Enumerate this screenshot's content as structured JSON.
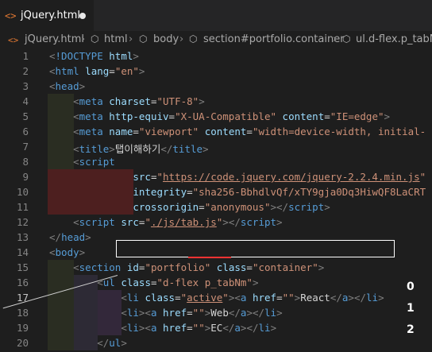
{
  "tab": {
    "icon": "<>",
    "label": "jQuery.html"
  },
  "breadcrumb": [
    "jQuery.html",
    "html",
    "body",
    "section#portfolio.container",
    "ul.d-flex.p_tabNm"
  ],
  "editor": {
    "current_line": 17,
    "lines": [
      {
        "n": "1",
        "tokens": [
          [
            "b",
            "<"
          ],
          [
            "t",
            "!DOCTYPE"
          ],
          [
            "w",
            " "
          ],
          [
            "a",
            "html"
          ],
          [
            "b",
            ">"
          ]
        ]
      },
      {
        "n": "2",
        "tokens": [
          [
            "b",
            "<"
          ],
          [
            "t",
            "html"
          ],
          [
            "w",
            " "
          ],
          [
            "a",
            "lang"
          ],
          [
            "w",
            "="
          ],
          [
            "s",
            "\"en\""
          ],
          [
            "b",
            ">"
          ]
        ]
      },
      {
        "n": "3",
        "tokens": [
          [
            "b",
            "<"
          ],
          [
            "t",
            "head"
          ],
          [
            "b",
            ">"
          ]
        ]
      },
      {
        "n": "4",
        "tokens": [
          [
            "w",
            "    "
          ],
          [
            "b",
            "<"
          ],
          [
            "t",
            "meta"
          ],
          [
            "w",
            " "
          ],
          [
            "a",
            "charset"
          ],
          [
            "w",
            "="
          ],
          [
            "s",
            "\"UTF-8\""
          ],
          [
            "b",
            ">"
          ]
        ]
      },
      {
        "n": "5",
        "tokens": [
          [
            "w",
            "    "
          ],
          [
            "b",
            "<"
          ],
          [
            "t",
            "meta"
          ],
          [
            "w",
            " "
          ],
          [
            "a",
            "http-equiv"
          ],
          [
            "w",
            "="
          ],
          [
            "s",
            "\"X-UA-Compatible\""
          ],
          [
            "w",
            " "
          ],
          [
            "a",
            "content"
          ],
          [
            "w",
            "="
          ],
          [
            "s",
            "\"IE=edge\""
          ],
          [
            "b",
            ">"
          ]
        ]
      },
      {
        "n": "6",
        "tokens": [
          [
            "w",
            "    "
          ],
          [
            "b",
            "<"
          ],
          [
            "t",
            "meta"
          ],
          [
            "w",
            " "
          ],
          [
            "a",
            "name"
          ],
          [
            "w",
            "="
          ],
          [
            "s",
            "\"viewport\""
          ],
          [
            "w",
            " "
          ],
          [
            "a",
            "content"
          ],
          [
            "w",
            "="
          ],
          [
            "s",
            "\"width=device-width, initial-"
          ]
        ]
      },
      {
        "n": "7",
        "tokens": [
          [
            "w",
            "    "
          ],
          [
            "b",
            "<"
          ],
          [
            "t",
            "title"
          ],
          [
            "b",
            ">"
          ],
          [
            "w",
            "탭이해하기"
          ],
          [
            "b",
            "</"
          ],
          [
            "t",
            "title"
          ],
          [
            "b",
            ">"
          ]
        ]
      },
      {
        "n": "8",
        "tokens": [
          [
            "w",
            "    "
          ],
          [
            "b",
            "<"
          ],
          [
            "t",
            "script"
          ]
        ]
      },
      {
        "n": "9",
        "tokens": [
          [
            "w",
            "              "
          ],
          [
            "a",
            "src"
          ],
          [
            "w",
            "="
          ],
          [
            "s",
            "\""
          ],
          [
            "su",
            "https://code.jquery.com/jquery-2.2.4.min.js"
          ],
          [
            "s",
            "\""
          ]
        ]
      },
      {
        "n": "10",
        "tokens": [
          [
            "w",
            "              "
          ],
          [
            "a",
            "integrity"
          ],
          [
            "w",
            "="
          ],
          [
            "s",
            "\"sha256-BbhdlvQf/xTY9gja0Dq3HiwQF8LaCRT"
          ]
        ]
      },
      {
        "n": "11",
        "tokens": [
          [
            "w",
            "              "
          ],
          [
            "a",
            "crossorigin"
          ],
          [
            "w",
            "="
          ],
          [
            "s",
            "\"anonymous\""
          ],
          [
            "b",
            "></"
          ],
          [
            "t",
            "script"
          ],
          [
            "b",
            ">"
          ]
        ]
      },
      {
        "n": "12",
        "tokens": [
          [
            "w",
            "    "
          ],
          [
            "b",
            "<"
          ],
          [
            "t",
            "script"
          ],
          [
            "w",
            " "
          ],
          [
            "a",
            "src"
          ],
          [
            "w",
            "="
          ],
          [
            "s",
            "\""
          ],
          [
            "su",
            "./js/tab.js"
          ],
          [
            "s",
            "\""
          ],
          [
            "b",
            "></"
          ],
          [
            "t",
            "script"
          ],
          [
            "b",
            ">"
          ]
        ]
      },
      {
        "n": "13",
        "tokens": [
          [
            "b",
            "</"
          ],
          [
            "t",
            "head"
          ],
          [
            "b",
            ">"
          ]
        ]
      },
      {
        "n": "14",
        "tokens": [
          [
            "b",
            "<"
          ],
          [
            "t",
            "body"
          ],
          [
            "b",
            ">"
          ]
        ]
      },
      {
        "n": "15",
        "tokens": [
          [
            "w",
            "    "
          ],
          [
            "b",
            "<"
          ],
          [
            "t",
            "section"
          ],
          [
            "w",
            " "
          ],
          [
            "a",
            "id"
          ],
          [
            "w",
            "="
          ],
          [
            "s",
            "\"portfolio\""
          ],
          [
            "w",
            " "
          ],
          [
            "a",
            "class"
          ],
          [
            "w",
            "="
          ],
          [
            "s",
            "\"container\""
          ],
          [
            "b",
            ">"
          ]
        ]
      },
      {
        "n": "16",
        "tokens": [
          [
            "w",
            "        "
          ],
          [
            "b",
            "<"
          ],
          [
            "t",
            "ul"
          ],
          [
            "w",
            " "
          ],
          [
            "a",
            "class"
          ],
          [
            "w",
            "="
          ],
          [
            "s",
            "\"d-flex p_tabNm\""
          ],
          [
            "b",
            ">"
          ]
        ]
      },
      {
        "n": "17",
        "tokens": [
          [
            "w",
            "            "
          ],
          [
            "b",
            "<"
          ],
          [
            "t",
            "li"
          ],
          [
            "w",
            " "
          ],
          [
            "a",
            "class"
          ],
          [
            "w",
            "="
          ],
          [
            "s",
            "\""
          ],
          [
            "su",
            "active"
          ],
          [
            "s",
            "\""
          ],
          [
            "b",
            "><"
          ],
          [
            "t",
            "a"
          ],
          [
            "w",
            " "
          ],
          [
            "a",
            "href"
          ],
          [
            "w",
            "="
          ],
          [
            "s",
            "\"\""
          ],
          [
            "b",
            ">"
          ],
          [
            "w",
            "React"
          ],
          [
            "b",
            "</"
          ],
          [
            "t",
            "a"
          ],
          [
            "b",
            "></"
          ],
          [
            "t",
            "li"
          ],
          [
            "b",
            ">"
          ]
        ]
      },
      {
        "n": "18",
        "tokens": [
          [
            "w",
            "            "
          ],
          [
            "b",
            "<"
          ],
          [
            "t",
            "li"
          ],
          [
            "b",
            "><"
          ],
          [
            "t",
            "a"
          ],
          [
            "w",
            " "
          ],
          [
            "a",
            "href"
          ],
          [
            "w",
            "="
          ],
          [
            "s",
            "\"\""
          ],
          [
            "b",
            ">"
          ],
          [
            "w",
            "Web"
          ],
          [
            "b",
            "</"
          ],
          [
            "t",
            "a"
          ],
          [
            "b",
            "></"
          ],
          [
            "t",
            "li"
          ],
          [
            "b",
            ">"
          ]
        ]
      },
      {
        "n": "19",
        "tokens": [
          [
            "w",
            "            "
          ],
          [
            "b",
            "<"
          ],
          [
            "t",
            "li"
          ],
          [
            "b",
            "><"
          ],
          [
            "t",
            "a"
          ],
          [
            "w",
            " "
          ],
          [
            "a",
            "href"
          ],
          [
            "w",
            "="
          ],
          [
            "s",
            "\"\""
          ],
          [
            "b",
            ">"
          ],
          [
            "w",
            "EC"
          ],
          [
            "b",
            "</"
          ],
          [
            "t",
            "a"
          ],
          [
            "b",
            "></"
          ],
          [
            "t",
            "li"
          ],
          [
            "b",
            ">"
          ]
        ]
      },
      {
        "n": "20",
        "tokens": [
          [
            "w",
            "        "
          ],
          [
            "b",
            "</"
          ],
          [
            "t",
            "ul"
          ],
          [
            "b",
            ">"
          ]
        ]
      }
    ]
  },
  "annotations": [
    "0",
    "1",
    "2"
  ]
}
